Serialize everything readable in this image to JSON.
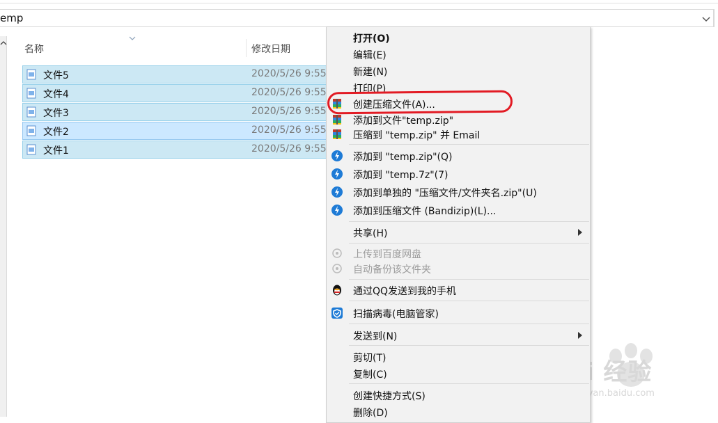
{
  "address_bar": {
    "path": "emp"
  },
  "columns": {
    "name": "名称",
    "date": "修改日期"
  },
  "files": [
    {
      "name": "文件5",
      "date": "2020/5/26 9:55",
      "state": "selected"
    },
    {
      "name": "文件4",
      "date": "2020/5/26 9:55",
      "state": "selected"
    },
    {
      "name": "文件3",
      "date": "2020/5/26 9:55",
      "state": "selected"
    },
    {
      "name": "文件2",
      "date": "2020/5/26 9:55",
      "state": "focused"
    },
    {
      "name": "文件1",
      "date": "2020/5/26 9:55",
      "state": "selected"
    }
  ],
  "context_menu": {
    "open": "打开(O)",
    "edit": "编辑(E)",
    "new": "新建(N)",
    "print": "打印(P)",
    "create_archive": "创建压缩文件(A)...",
    "add_to_temp_zip": "添加到文件\"temp.zip\"",
    "compress_email": "压缩到 \"temp.zip\" 并 Email",
    "bz_add_zip": "添加到 \"temp.zip\"(Q)",
    "bz_add_7z": "添加到 \"temp.7z\"(7)",
    "bz_add_separate": "添加到单独的 \"压缩文件/文件夹名.zip\"(U)",
    "bz_add_bandizip": "添加到压缩文件 (Bandizip)(L)...",
    "share": "共享(H)",
    "upload_baidu": "上传到百度网盘",
    "auto_backup": "自动备份该文件夹",
    "send_qq": "通过QQ发送到我的手机",
    "scan_virus": "扫描病毒(电脑管家)",
    "send_to": "发送到(N)",
    "cut": "剪切(T)",
    "copy": "复制(C)",
    "create_shortcut": "创建快捷方式(S)",
    "delete": "删除(D)"
  },
  "watermark": {
    "brand": "Bai  经验",
    "url": "jingyan.baidu.com"
  },
  "colors": {
    "selection": "#cce8f4",
    "highlight_oval": "#e21b24",
    "bandizip_blue": "#1e7bd6"
  }
}
